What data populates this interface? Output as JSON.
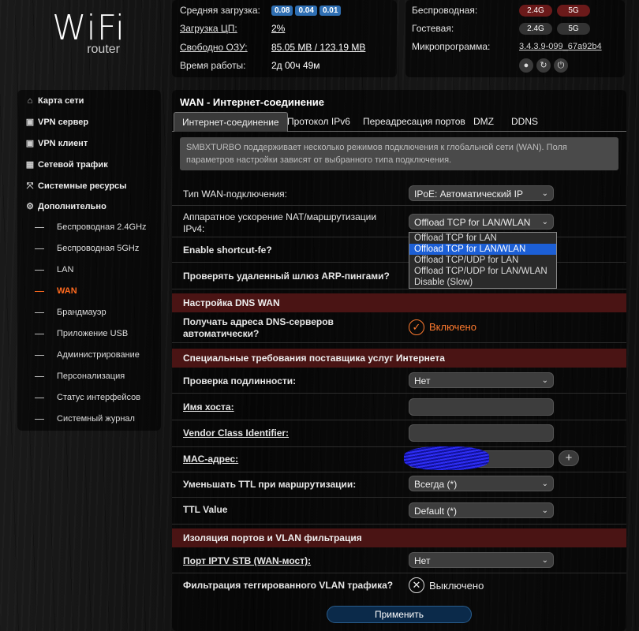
{
  "brand": {
    "wifi": "WiFi",
    "router": "router"
  },
  "status": {
    "load": {
      "label": "Средняя загрузка:",
      "values": [
        "0.08",
        "0.04",
        "0.01"
      ]
    },
    "cpu": {
      "label": "Загрузка ЦП:",
      "value": "2%"
    },
    "ram": {
      "label": "Свободно ОЗУ:",
      "value": "85.05 MB / 123.19 MB"
    },
    "uptime": {
      "label": "Время работы:",
      "value": "2д 00ч 49м"
    },
    "wireless": {
      "label": "Беспроводная:",
      "bands": [
        "2.4G",
        "5G"
      ]
    },
    "guest": {
      "label": "Гостевая:",
      "bands": [
        "2.4G",
        "5G"
      ]
    },
    "firmware": {
      "label": "Микропрограмма:",
      "value": "3.4.3.9-099_67a92b4"
    }
  },
  "sidebar": {
    "items": [
      {
        "label": "Карта сети",
        "icon": "home-icon"
      },
      {
        "label": "VPN сервер",
        "icon": "vpn-server-icon"
      },
      {
        "label": "VPN клиент",
        "icon": "vpn-client-icon"
      },
      {
        "label": "Сетевой трафик",
        "icon": "traffic-icon"
      },
      {
        "label": "Системные ресурсы",
        "icon": "resources-icon"
      },
      {
        "label": "Дополнительно",
        "icon": "gear-icon"
      }
    ],
    "subitems": [
      "Беспроводная 2.4GHz",
      "Беспроводная 5GHz",
      "LAN",
      "WAN",
      "Брандмауэр",
      "Приложение USB",
      "Администрирование",
      "Персонализация",
      "Статус интерфейсов",
      "Системный журнал"
    ]
  },
  "main": {
    "title": "WAN - Интернет-соединение",
    "tabs": [
      "Интернет-соединение",
      "Протокол IPv6",
      "Переадресация портов",
      "DMZ",
      "DDNS"
    ],
    "info": "SMBXTURBO поддерживает несколько режимов подключения к глобальной сети (WAN). Поля параметров настройки зависят от выбранного типа подключения.",
    "wan_type": {
      "label": "Тип WAN-подключения:",
      "value": "IPoE: Автоматический IP"
    },
    "nat_accel": {
      "label": "Аппаратное ускорение NAT/маршрутизации IPv4:",
      "value": "Offload TCP for LAN/WLAN"
    },
    "nat_options": [
      "Offload TCP for LAN",
      "Offload TCP for LAN/WLAN",
      "Offload TCP/UDP for LAN",
      "Offload TCP/UDP for LAN/WLAN",
      "Disable (Slow)"
    ],
    "shortcut": {
      "label": "Enable shortcut-fe?"
    },
    "arp": {
      "label": "Проверять удаленный шлюз ARP-пингами?"
    },
    "dns_section": "Настройка DNS WAN",
    "dns_auto": {
      "label": "Получать адреса DNS-серверов автоматически?",
      "state": "Включено"
    },
    "isp_section": "Специальные требования поставщика услуг Интернета",
    "auth": {
      "label": "Проверка подлинности:",
      "value": "Нет"
    },
    "hostname": {
      "label": "Имя хоста:"
    },
    "vendor": {
      "label": "Vendor Class Identifier:"
    },
    "mac": {
      "label": "MAC-адрес:",
      "plus": "+"
    },
    "ttl_reduce": {
      "label": "Уменьшать TTL при маршрутизации:",
      "value": "Всегда (*)"
    },
    "ttl_value": {
      "label": "TTL Value",
      "value": "Default (*)"
    },
    "vlan_section": "Изоляция портов и VLAN фильтрация",
    "iptv": {
      "label": "Порт IPTV STB (WAN-мост):",
      "value": "Нет"
    },
    "vlan_filter": {
      "label": "Фильтрация теггированного VLAN трафика?",
      "state": "Выключено"
    },
    "apply": "Применить"
  },
  "colors": {
    "accent": "#ff6a1f",
    "section": "#4a1414",
    "badge": "#2f6fb3",
    "highlight": "#1c5fd6"
  }
}
